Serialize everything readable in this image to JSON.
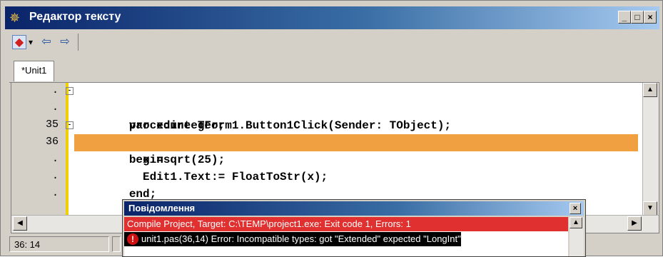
{
  "window": {
    "title": "Редактор тексту",
    "icon": "gear-app-icon",
    "buttons": {
      "minimize": "_",
      "maximize": "□",
      "close": "×"
    }
  },
  "toolbar": {
    "tools": [
      {
        "name": "breakpoint-icon",
        "glyph": "◆"
      },
      {
        "name": "dropdown-arrow-icon",
        "glyph": "▾"
      },
      {
        "name": "back-icon",
        "glyph": "⇦"
      },
      {
        "name": "forward-icon",
        "glyph": "⇨"
      }
    ]
  },
  "tabs": [
    {
      "label": "*Unit1"
    }
  ],
  "editor": {
    "gutter": [
      ".",
      ".",
      "35",
      "36",
      ".",
      ".",
      "."
    ],
    "lines": [
      "procedure TForm1.Button1Click(Sender: TObject);",
      "var x:integer;",
      "begin",
      "  x:=sqrt(25);",
      "  Edit1.Text:= FloatToStr(x);",
      "end;"
    ],
    "highlight_line": 4,
    "highlight_color": "#f0a040",
    "fold_markers": [
      "-",
      "-"
    ]
  },
  "status": {
    "position": "36: 14"
  },
  "messages": {
    "title": "Повідомлення",
    "rows": [
      {
        "text": "Compile Project, Target: C:\\TEMP\\project1.exe: Exit code 1, Errors: 1",
        "color": "#e03030"
      },
      {
        "text": "unit1.pas(36,14) Error: Incompatible types: got \"Extended\" expected \"LongInt\"",
        "icon": "error-icon"
      }
    ],
    "close": "×"
  }
}
